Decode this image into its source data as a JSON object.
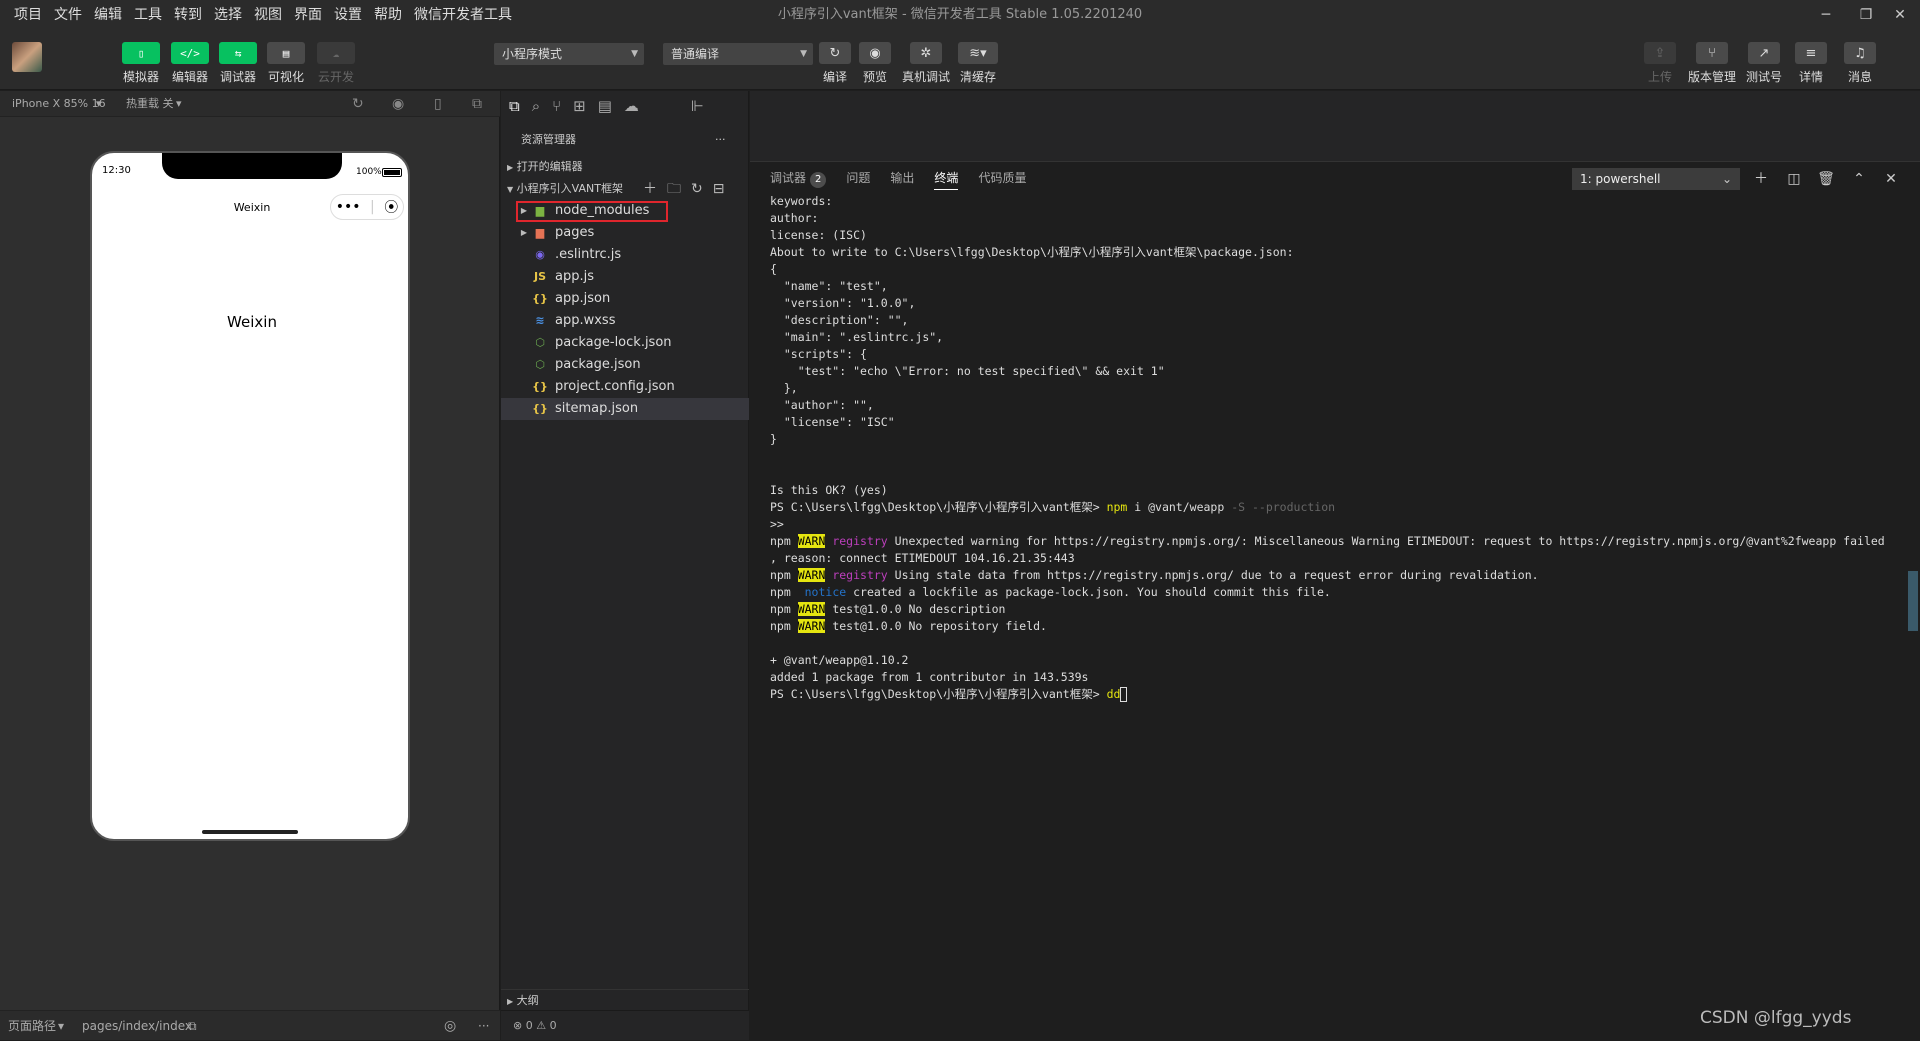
{
  "window": {
    "title": "小程序引入vant框架 - 微信开发者工具 Stable 1.05.2201240",
    "menus": [
      "项目",
      "文件",
      "编辑",
      "工具",
      "转到",
      "选择",
      "视图",
      "界面",
      "设置",
      "帮助",
      "微信开发者工具"
    ]
  },
  "toolbar": {
    "mode_buttons": [
      "模拟器",
      "编辑器",
      "调试器",
      "可视化",
      "云开发"
    ],
    "mode_select": "小程序模式",
    "compile_select": "普通编译",
    "actions": [
      "编译",
      "预览",
      "真机调试",
      "清缓存"
    ],
    "right_actions": [
      "上传",
      "版本管理",
      "测试号",
      "详情",
      "消息"
    ]
  },
  "simulator": {
    "device": "iPhone X 85% 16",
    "hot_reload": "热重载 关",
    "status_time": "12:30",
    "battery": "100%",
    "nav_title": "Weixin",
    "page_text": "Weixin",
    "footer_path_label": "页面路径",
    "footer_path": "pages/index/index"
  },
  "explorer": {
    "title": "资源管理器",
    "open_editors": "打开的编辑器",
    "project": "小程序引入VANT框架",
    "files": [
      {
        "name": "node_modules",
        "icon": "folder-green"
      },
      {
        "name": "pages",
        "icon": "folder-orange"
      },
      {
        "name": ".eslintrc.js",
        "icon": "eslint"
      },
      {
        "name": "app.js",
        "icon": "js"
      },
      {
        "name": "app.json",
        "icon": "json"
      },
      {
        "name": "app.wxss",
        "icon": "css"
      },
      {
        "name": "package-lock.json",
        "icon": "npm"
      },
      {
        "name": "package.json",
        "icon": "npm"
      },
      {
        "name": "project.config.json",
        "icon": "json"
      },
      {
        "name": "sitemap.json",
        "icon": "json"
      }
    ],
    "outline": "大纲",
    "status": "⊗ 0 ⚠ 0"
  },
  "terminal": {
    "tabs": [
      "调试器",
      "问题",
      "输出",
      "终端",
      "代码质量"
    ],
    "debugger_badge": "2",
    "shell": "1: powershell",
    "lines": [
      "keywords:",
      "author:",
      "license: (ISC)",
      "About to write to C:\\Users\\lfgg\\Desktop\\小程序\\小程序引入vant框架\\package.json:",
      "",
      "{",
      "  \"name\": \"test\",",
      "  \"version\": \"1.0.0\",",
      "  \"description\": \"\",",
      "  \"main\": \".eslintrc.js\",",
      "  \"scripts\": {",
      "    \"test\": \"echo \\\"Error: no test specified\\\" && exit 1\"",
      "  },",
      "  \"author\": \"\",",
      "  \"license\": \"ISC\"",
      "}",
      "",
      "",
      "Is this OK? (yes)"
    ],
    "prompt": "PS C:\\Users\\lfgg\\Desktop\\小程序\\小程序引入vant框架> ",
    "cmd1": "npm",
    "cmd1_args": " i @vant/weapp ",
    "cmd1_flags": "-S --production",
    "continuation": ">>",
    "npm": "npm ",
    "warn": "WARN",
    "registry": " registry",
    "notice": " notice",
    "msg1": " Unexpected warning for https://registry.npmjs.org/: Miscellaneous Warning ETIMEDOUT: request to https://registry.npmjs.org/@vant%2fweapp failed",
    "msg1b": ", reason: connect ETIMEDOUT 104.16.21.35:443",
    "msg2": " Using stale data from https://registry.npmjs.org/ due to a request error during revalidation.",
    "msg3": " created a lockfile as package-lock.json. You should commit this file.",
    "msg4": " test@1.0.0 No description",
    "msg5": " test@1.0.0 No repository field.",
    "added1": "+ @vant/weapp@1.10.2",
    "added2": "added 1 package from 1 contributor in 143.539s",
    "typed": "dd"
  },
  "watermark": "CSDN @lfgg_yyds"
}
